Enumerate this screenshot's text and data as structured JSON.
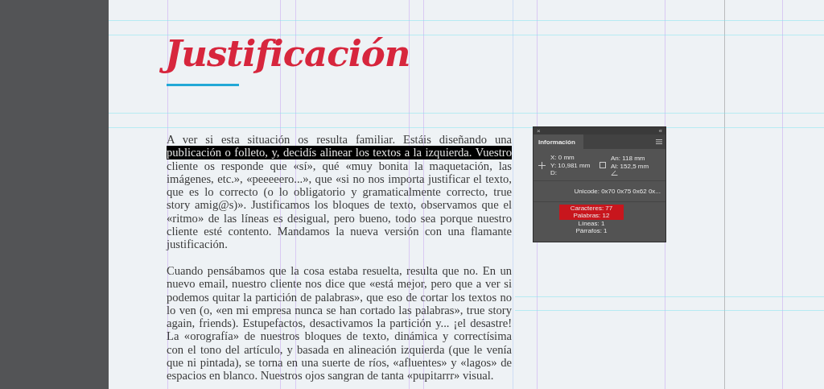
{
  "title": "Justificación",
  "paragraphs": [
    {
      "lines": [
        {
          "text": "A ver si esta situación os resulta familiar. Estáis diseñando una",
          "selected": false
        },
        {
          "text": "publicación o folleto, y, decidís alinear los textos a la izquierda. Vuestro",
          "selected": true
        },
        {
          "text": "cliente os responde que «sí», qué «muy bonita la maquetación, las",
          "selected": false
        },
        {
          "text": "imágenes, etc.», «peeeeero...», que «si no nos importa justificar el texto,",
          "selected": false
        },
        {
          "text": "que es lo correcto (o lo obligatorio y gramaticalmente correcto, true",
          "selected": false
        },
        {
          "text": "story amig@s)». Justificamos los bloques de texto, observamos que el",
          "selected": false
        },
        {
          "text": "«ritmo» de las líneas es desigual, pero bueno, todo sea porque nuestro",
          "selected": false
        },
        {
          "text": "cliente esté contento. Mandamos la nueva versión con una flamante",
          "selected": false
        },
        {
          "text": "justificación.",
          "selected": false
        }
      ]
    },
    {
      "lines": [
        {
          "text": "Cuando pensábamos que la cosa estaba resuelta, resulta que no. En un",
          "selected": false
        },
        {
          "text": "nuevo email, nuestro cliente nos dice que «está mejor, pero que a ver si",
          "selected": false
        },
        {
          "text": "podemos quitar la partición de palabras», que eso de cortar los textos no",
          "selected": false
        },
        {
          "text": "lo ven (o, «en mi empresa nunca se han cortado las palabras», true story",
          "selected": false
        },
        {
          "text": "again, friends). Estupefactos, desactivamos la partición y... ¡el desastre!",
          "selected": false
        },
        {
          "text": "La «orografía» de nuestros bloques de texto, dinámica y correctísima",
          "selected": false
        },
        {
          "text": "con el tono del artículo, y basada en alineación izquierda (que le venía",
          "selected": false
        },
        {
          "text": "que ni pintada), se torna en una suerte de ríos, «afluentes» y «lagos» de",
          "selected": false
        },
        {
          "text": "espacios en blanco. Nuestros ojos sangran de tanta «pupitarrr» visual.",
          "selected": false
        }
      ]
    }
  ],
  "panel": {
    "close": "×",
    "collapse": "«",
    "tab": "Información",
    "left": [
      "X: 0 mm",
      "Y: 10,981 mm",
      "D:"
    ],
    "right": [
      "An: 118 mm",
      "Al: 152,5 mm"
    ],
    "unicode": "Unicode: 0x70 0x75 0x62 0x...",
    "stats": [
      {
        "text": "Caracteres: 77",
        "highlighted": true
      },
      {
        "text": "Palabras: 12",
        "highlighted": true
      },
      {
        "text": "Líneas: 1",
        "highlighted": false
      },
      {
        "text": "Párrafos: 1",
        "highlighted": false
      }
    ]
  }
}
